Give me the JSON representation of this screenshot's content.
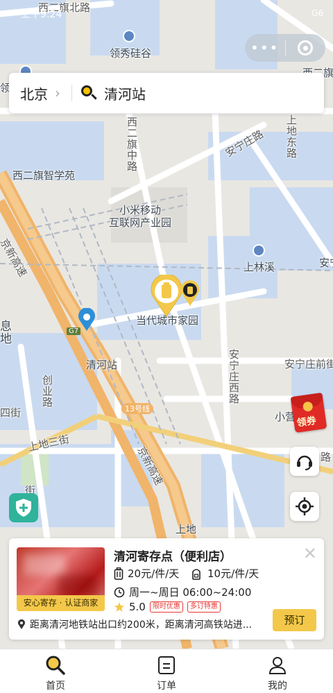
{
  "status_bar": {
    "time": "上午9:24",
    "right": "G6"
  },
  "search": {
    "city": "北京",
    "query": "清河站"
  },
  "map_labels": {
    "road_xierqi_north": "西二旗北路",
    "lingxiu": "领秀硅谷",
    "ling": "领",
    "xierqi_xi": "西二旗",
    "xierqi_middle_road": "西二旗中路",
    "anningzhuang_road": "安宁庄路",
    "shangdi_east": "上地东路",
    "xierqi_zhixue": "西二旗智学苑",
    "xiaomi": "小米移动\n互联网产业园",
    "jingxin": "京新高速",
    "shanglinxi": "上林溪",
    "an": "安宁",
    "dangdai": "当代城市家园",
    "xi_di": "息\n地",
    "g7": "G7",
    "qinghe_station": "清河站",
    "anningzhuang_front": "安宁庄前街",
    "anningzhuang_west": "安宁庄西路",
    "chuangye": "创业路",
    "xiaoying": "小营",
    "line13": "13号线",
    "si": "四街",
    "shangdi3": "上地三街",
    "jingxin2": "京新高速",
    "shangdi": "上地",
    "lu": "路",
    "street": "街"
  },
  "coupon_label": "领券",
  "card": {
    "title": "清河寄存点（便利店）",
    "tag": "安心寄存 · 认证商家",
    "price_suitcase": "20元/件/天",
    "price_bag": "10元/件/天",
    "hours": "周一~周日 06:00~24:00",
    "rating": "5.0",
    "badge1": "限时优惠",
    "badge2": "多订特惠",
    "book": "预订",
    "address": "距离清河地铁站出口约200米，距离清河高铁站进..."
  },
  "tabs": [
    {
      "label": "首页"
    },
    {
      "label": "订单"
    },
    {
      "label": "我的"
    }
  ],
  "colors": {
    "accent": "#f3c84a",
    "water_block": "#c9daf0",
    "highway": "#f0b46a",
    "pin_blue": "#2d8fd8",
    "coupon_red": "#e02a26",
    "shield_green": "#2fb39b"
  }
}
